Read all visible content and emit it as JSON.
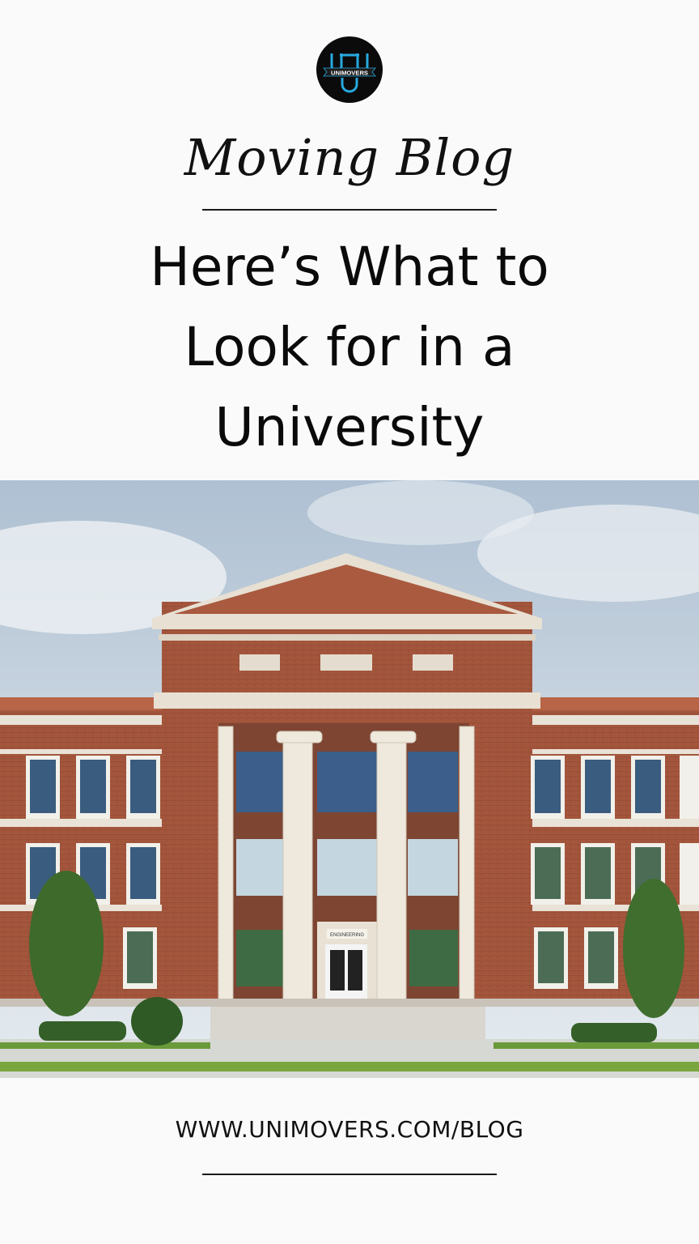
{
  "brand": {
    "logo_text": "UNIMOVERS",
    "colors": {
      "logo_bg": "#0b0b0b",
      "logo_accent": "#27a9df",
      "text": "#0a0a0a",
      "background": "#fafafa"
    }
  },
  "header": {
    "script_title": "Moving Blog",
    "headline_lines": [
      "Here’s What to",
      "Look for in a",
      "University"
    ]
  },
  "photo": {
    "sign_text": "ENGINEERING"
  },
  "footer": {
    "url": "WWW.UNIMOVERS.COM/BLOG"
  }
}
